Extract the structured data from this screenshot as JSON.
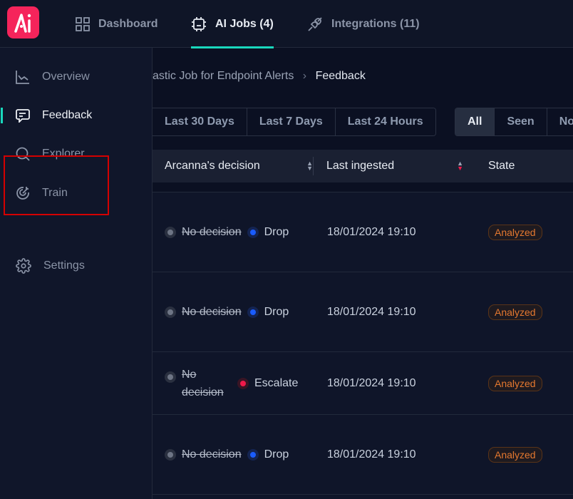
{
  "header": {
    "logo_text": "AI",
    "nav": [
      {
        "label": "Dashboard",
        "icon": "grid-icon"
      },
      {
        "label": "AI Jobs (4)",
        "icon": "chip-icon",
        "active": true
      },
      {
        "label": "Integrations (11)",
        "icon": "plug-icon"
      }
    ]
  },
  "sidebar": {
    "items": [
      {
        "label": "Overview",
        "icon": "chart-icon"
      },
      {
        "label": "Feedback",
        "icon": "message-icon",
        "active": true
      },
      {
        "label": "Explorer",
        "icon": "search-icon"
      },
      {
        "label": "Train",
        "icon": "target-icon"
      },
      {
        "label": "Settings",
        "icon": "gear-icon"
      }
    ]
  },
  "breadcrumb": {
    "parent": "astic Job for Endpoint Alerts",
    "separator": "›",
    "current": "Feedback"
  },
  "time_filters": [
    "Last 30 Days",
    "Last 7 Days",
    "Last 24 Hours"
  ],
  "status_filters": [
    "All",
    "Seen",
    "No"
  ],
  "table": {
    "columns": [
      "Arcanna's decision",
      "Last ingested",
      "State"
    ],
    "rows": [
      {
        "old": "No decision",
        "new": "Drop",
        "time": "18/01/2024 19:10",
        "state": "Analyzed"
      },
      {
        "old": "No decision",
        "new": "Drop",
        "time": "18/01/2024 19:10",
        "state": "Analyzed"
      },
      {
        "old": "No decision",
        "new": "Escalate",
        "time": "18/01/2024 19:10",
        "state": "Analyzed"
      },
      {
        "old": "No decision",
        "new": "Drop",
        "time": "18/01/2024 19:10",
        "state": "Analyzed"
      }
    ]
  },
  "colors": {
    "accent": "#19d8bd",
    "brand": "#f5245b",
    "drop": "#1a5cff",
    "escalate": "#f0194a",
    "analyzed": "#e4782f"
  }
}
